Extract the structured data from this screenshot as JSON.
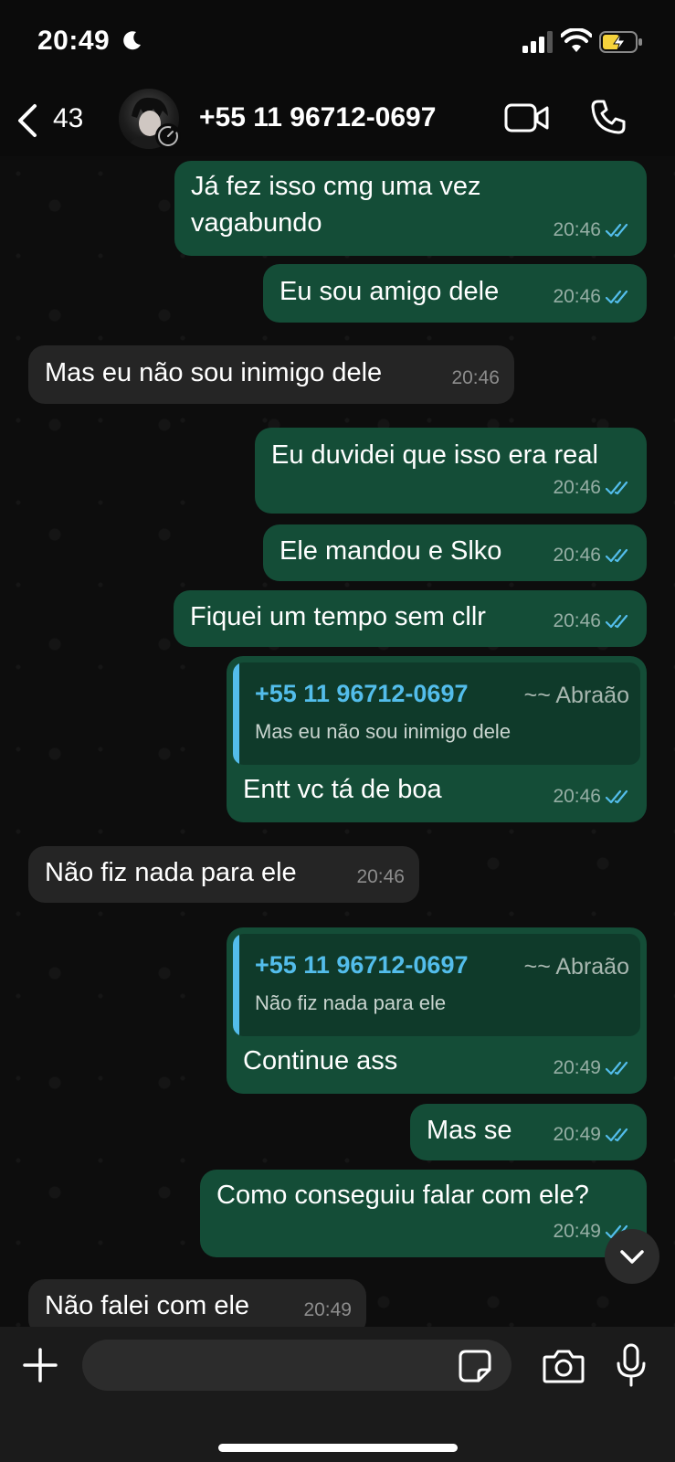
{
  "status_bar": {
    "time": "20:49"
  },
  "header": {
    "back_count": "43",
    "contact_name": "+55 11 96712-0697"
  },
  "messages": [
    {
      "dir": "out",
      "lines": [
        "Já fez isso cmg uma vez",
        "vagabundo"
      ],
      "time": "20:46"
    },
    {
      "dir": "out",
      "lines": [
        "Eu sou amigo dele"
      ],
      "time": "20:46"
    },
    {
      "dir": "in",
      "lines": [
        "Mas eu não sou inimigo dele"
      ],
      "time": "20:46"
    },
    {
      "dir": "out",
      "lines": [
        "Eu duvidei que isso era real"
      ],
      "time": "20:46"
    },
    {
      "dir": "out",
      "lines": [
        "Ele mandou e Slko"
      ],
      "time": "20:46"
    },
    {
      "dir": "out",
      "lines": [
        "Fiquei um tempo sem cllr"
      ],
      "time": "20:46"
    },
    {
      "dir": "out",
      "reply": {
        "name": "+55 11 96712-0697",
        "alias": "~~ Abraão",
        "text": "Mas eu não sou inimigo dele"
      },
      "lines": [
        "Entt vc tá de boa"
      ],
      "time": "20:46"
    },
    {
      "dir": "in",
      "lines": [
        "Não fiz nada para ele"
      ],
      "time": "20:46"
    },
    {
      "dir": "out",
      "reply": {
        "name": "+55 11 96712-0697",
        "alias": "~~ Abraão",
        "text": "Não fiz nada para ele"
      },
      "lines": [
        "Continue ass"
      ],
      "time": "20:49"
    },
    {
      "dir": "out",
      "lines": [
        "Mas se"
      ],
      "time": "20:49"
    },
    {
      "dir": "out",
      "lines": [
        "Como conseguiu falar com ele?"
      ],
      "time": "20:49"
    },
    {
      "dir": "in",
      "lines": [
        "Não falei com ele"
      ],
      "time": "20:49"
    }
  ],
  "input": {
    "placeholder": "",
    "value": ""
  },
  "colors": {
    "outgoing_bubble": "#144d37",
    "incoming_bubble": "#252525",
    "read_ticks": "#53bdeb",
    "quote_name": "#53bdeb"
  },
  "icons": [
    "moon-icon",
    "signal-icon",
    "wifi-icon",
    "battery-charging-icon",
    "back-chevron-icon",
    "video-call-icon",
    "phone-call-icon",
    "read-ticks-icon",
    "scroll-down-icon",
    "plus-icon",
    "sticker-icon",
    "camera-icon",
    "microphone-icon"
  ]
}
